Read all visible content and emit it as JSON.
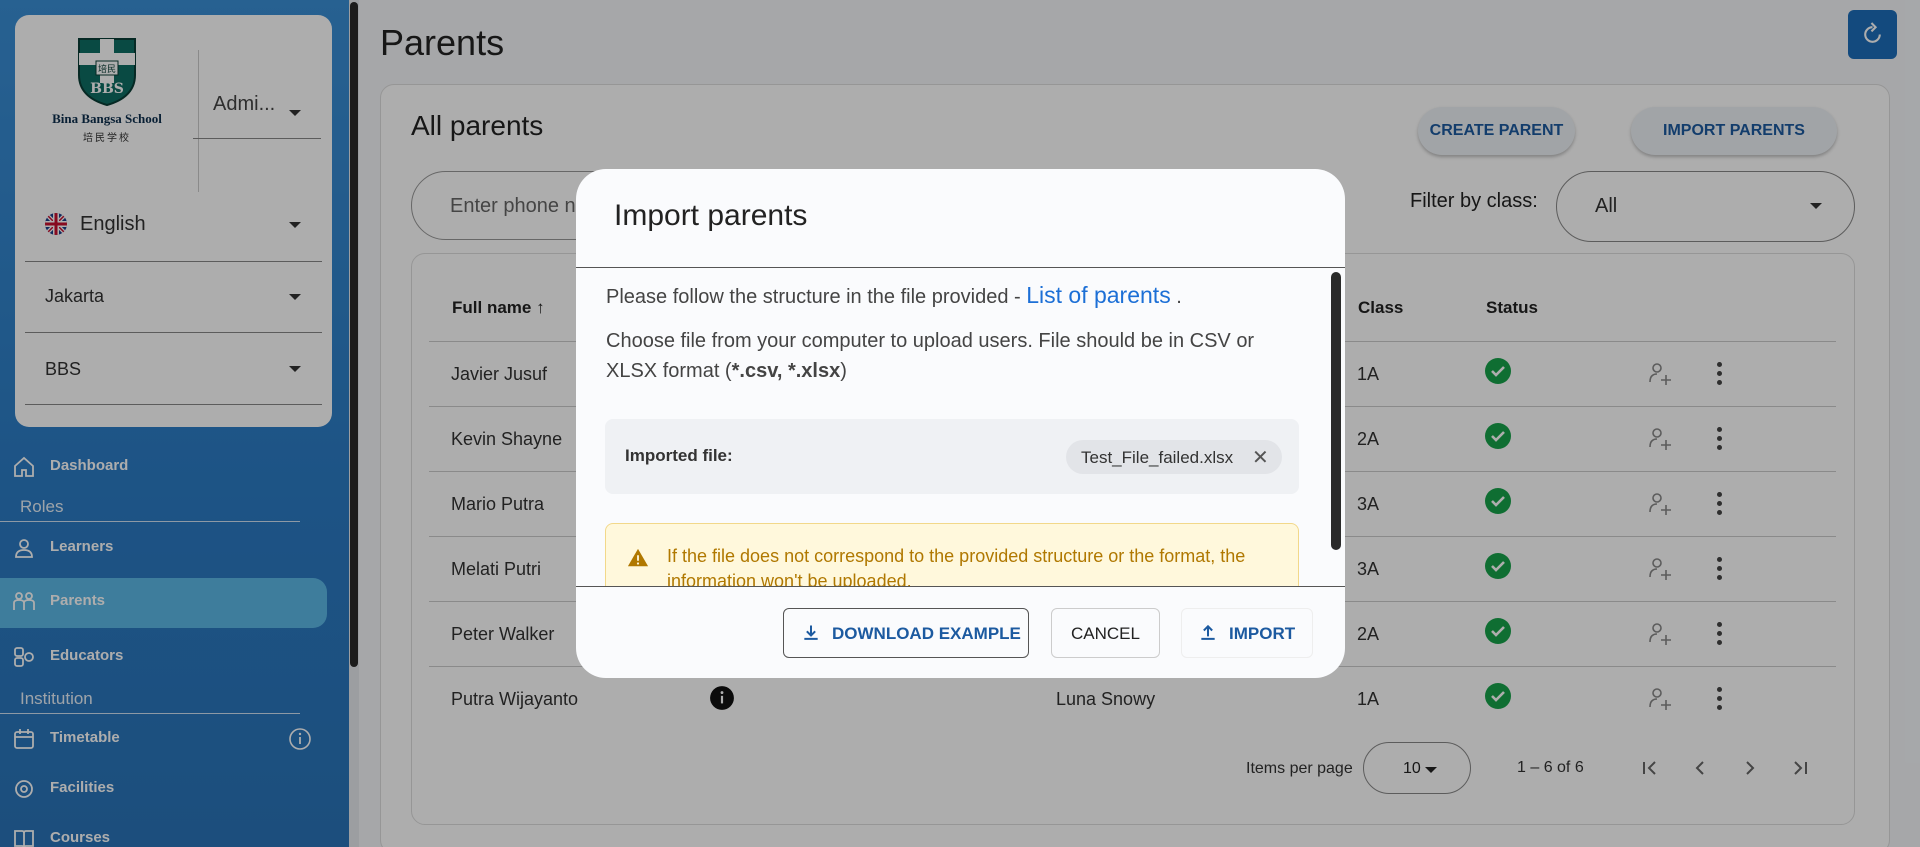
{
  "sidebar": {
    "school_name": "Bina Bangsa School",
    "school_chinese": "培民学校",
    "logo_letters": "BBS",
    "logo_top_chars": "培民",
    "role_select": "Admi...",
    "language": "English",
    "city": "Jakarta",
    "school_select": "BBS",
    "nav": {
      "dashboard": "Dashboard",
      "roles_section": "Roles",
      "learners": "Learners",
      "parents": "Parents",
      "educators": "Educators",
      "institution_section": "Institution",
      "timetable": "Timetable",
      "facilities": "Facilities",
      "courses": "Courses"
    }
  },
  "page": {
    "title": "Parents",
    "panel_title": "All parents",
    "create_button": "CREATE PARENT",
    "import_button": "IMPORT PARENTS",
    "search_placeholder": "Enter phone n",
    "filter_label": "Filter by class:",
    "filter_value": "All"
  },
  "table": {
    "headers": {
      "full_name": "Full name",
      "class": "Class",
      "status": "Status"
    },
    "rows": [
      {
        "name": "Javier Jusuf",
        "class": "1A"
      },
      {
        "name": "Kevin Shayne",
        "class": "2A"
      },
      {
        "name": "Mario Putra",
        "class": "3A"
      },
      {
        "name": "Melati Putri",
        "class": "3A"
      },
      {
        "name": "Peter Walker",
        "class": "2A"
      },
      {
        "name": "Putra Wijayanto",
        "learner": "Luna Snowy",
        "class": "1A"
      }
    ],
    "items_per_page_label": "Items per page",
    "items_per_page": "10",
    "range": "1 – 6 of 6"
  },
  "dialog": {
    "title": "Import parents",
    "instruction_prefix": "Please follow the structure in the file provided - ",
    "instruction_link": "List of parents",
    "instruction_suffix": " .",
    "choose_text_1": "Choose file from your computer to upload users. File should be in CSV or",
    "choose_text_2a": "XLSX format (",
    "choose_text_2b": "*.csv, *.xlsx",
    "choose_text_2c": ")",
    "imported_label": "Imported file:",
    "file_name": "Test_File_failed.xlsx",
    "warning_1": "If the file does not correspond to the provided structure or the format, the",
    "warning_2": "information won't be uploaded.",
    "download_button": "DOWNLOAD EXAMPLE",
    "cancel_button": "CANCEL",
    "import_button": "IMPORT"
  },
  "colors": {
    "accent": "#1c6eba",
    "status_ok": "#17a34a",
    "warning": "#b07800"
  }
}
